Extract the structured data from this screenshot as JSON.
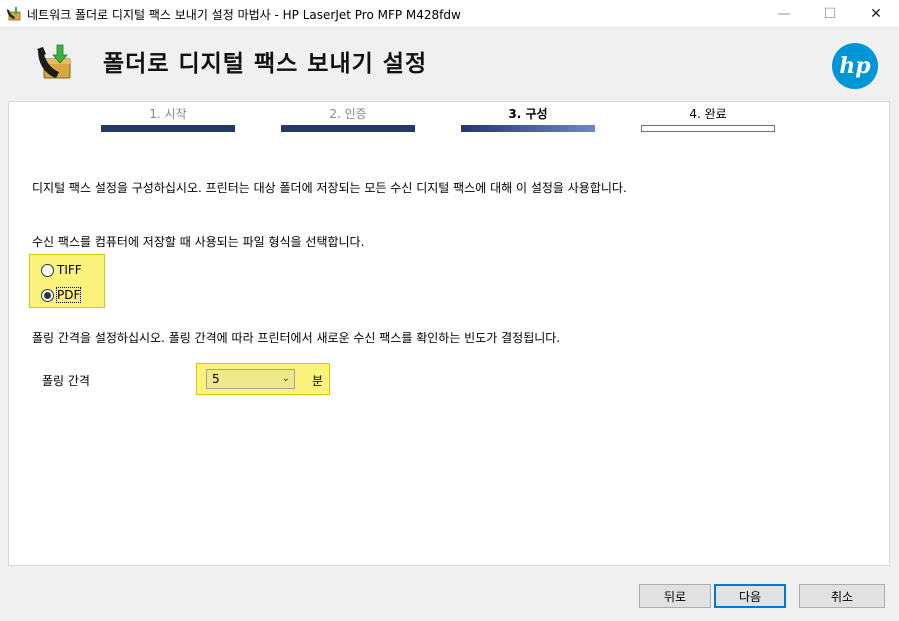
{
  "window": {
    "title": "네트워크 폴더로 디지털 팩스 보내기 설정 마법사 - HP LaserJet Pro MFP M428fdw"
  },
  "header": {
    "heading": "폴더로 디지털 팩스 보내기 설정",
    "logo_icon": "hp-logo-icon",
    "fax_icon": "fax-folder-icon"
  },
  "steps": [
    {
      "label": "1. 시작",
      "state": "done"
    },
    {
      "label": "2. 인증",
      "state": "done"
    },
    {
      "label": "3. 구성",
      "state": "active"
    },
    {
      "label": "4. 완료",
      "state": "todo"
    }
  ],
  "content": {
    "description": "디지털 팩스 설정을 구성하십시오. 프린터는 대상 폴더에 저장되는 모든 수신 디지털 팩스에 대해 이 설정을 사용합니다.",
    "format_prompt": "수신 팩스를 컴퓨터에 저장할 때 사용되는 파일 형식을 선택합니다.",
    "format_options": [
      {
        "label": "TIFF",
        "checked": false
      },
      {
        "label": "PDF",
        "checked": true
      }
    ],
    "polling_prompt": "폴링 간격을 설정하십시오. 폴링 간격에 따라 프린터에서 새로운 수신 팩스를 확인하는 빈도가 결정됩니다.",
    "polling_label": "폴링 간격",
    "polling_value": "5",
    "polling_unit": "분"
  },
  "buttons": {
    "back": "뒤로",
    "next": "다음",
    "cancel": "취소"
  },
  "colors": {
    "highlight": "#fbf37b",
    "step_done": "#24386a",
    "hp_blue": "#0096d6",
    "focus_blue": "#0078d7"
  }
}
